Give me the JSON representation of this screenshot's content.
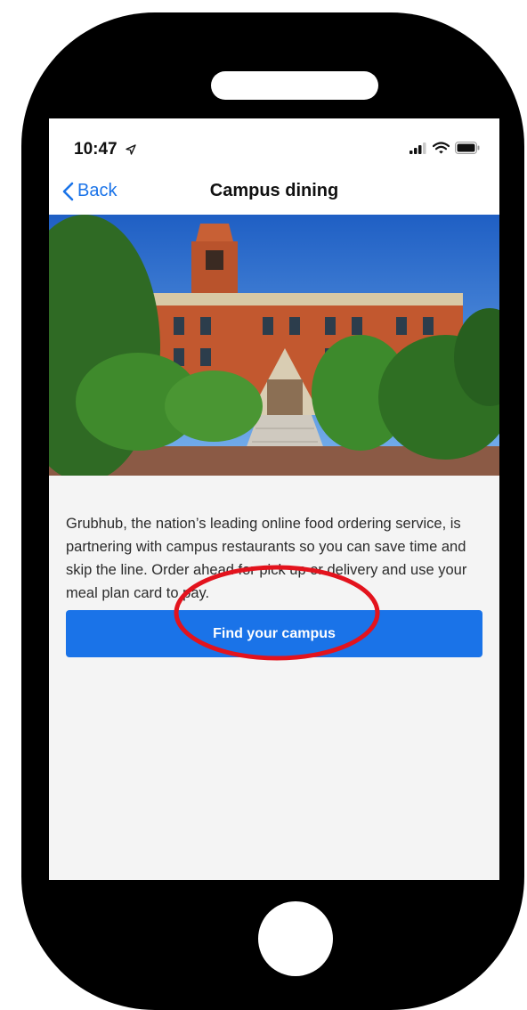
{
  "status_bar": {
    "time": "10:47",
    "icons": [
      "location-arrow-icon",
      "signal-icon",
      "wifi-icon",
      "battery-icon"
    ]
  },
  "nav": {
    "back_label": "Back",
    "title": "Campus dining"
  },
  "hero_image": {
    "description_icon": "campus-building-photo"
  },
  "description": "Grubhub, the nation’s leading online food ordering service, is partnering with campus restaurants so you can save time and skip the line. Order ahead for pick up or delivery and use your meal plan card to pay.",
  "cta": {
    "label": "Find your campus"
  },
  "colors": {
    "accent": "#1a73e8",
    "highlight_ring": "#e3131d",
    "phone_frame": "#000000",
    "screen_bg": "#f4f4f4"
  }
}
